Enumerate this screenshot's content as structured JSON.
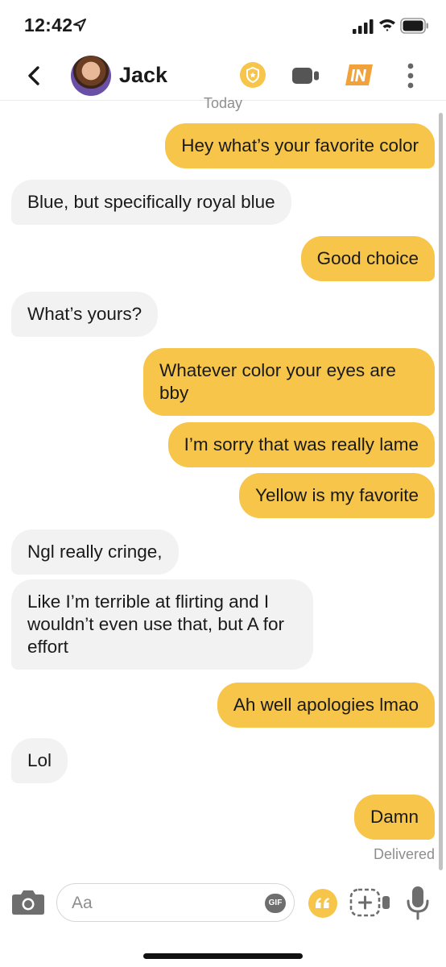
{
  "status_bar": {
    "time": "12:42"
  },
  "header": {
    "contact_name": "Jack"
  },
  "conversation": {
    "date_label": "Today",
    "messages": [
      {
        "direction": "outgoing",
        "text": "Hey what’s your favorite color"
      },
      {
        "direction": "incoming",
        "text": "Blue, but specifically royal blue"
      },
      {
        "direction": "outgoing",
        "text": "Good choice"
      },
      {
        "direction": "incoming",
        "text": "What’s yours?"
      },
      {
        "direction": "outgoing",
        "text": "Whatever color your eyes are bby"
      },
      {
        "direction": "outgoing",
        "text": "I’m sorry that was really lame"
      },
      {
        "direction": "outgoing",
        "text": "Yellow is my favorite"
      },
      {
        "direction": "incoming",
        "text": "Ngl really cringe,"
      },
      {
        "direction": "incoming",
        "text": "Like I’m terrible at flirting and I wouldn’t even use that, but A for effort"
      },
      {
        "direction": "outgoing",
        "text": "Ah well apologies lmao"
      },
      {
        "direction": "incoming",
        "text": "Lol"
      },
      {
        "direction": "outgoing",
        "text": "Damn"
      }
    ],
    "delivery_status": "Delivered"
  },
  "composer": {
    "placeholder": "Aa",
    "value": "",
    "gif_label": "GIF"
  },
  "colors": {
    "outgoing_bubble": "#f6c54a",
    "incoming_bubble": "#f2f2f2",
    "accent": "#f6c54a",
    "icon_gray": "#6e6e6e"
  },
  "icons": [
    "location-arrow-icon",
    "signal-icon",
    "wifi-icon",
    "battery-icon",
    "back-chevron-icon",
    "verified-badge-icon",
    "video-call-icon",
    "in-badge-icon",
    "more-vertical-icon",
    "camera-icon",
    "gif-icon",
    "quote-icon",
    "video-note-icon",
    "microphone-icon"
  ]
}
